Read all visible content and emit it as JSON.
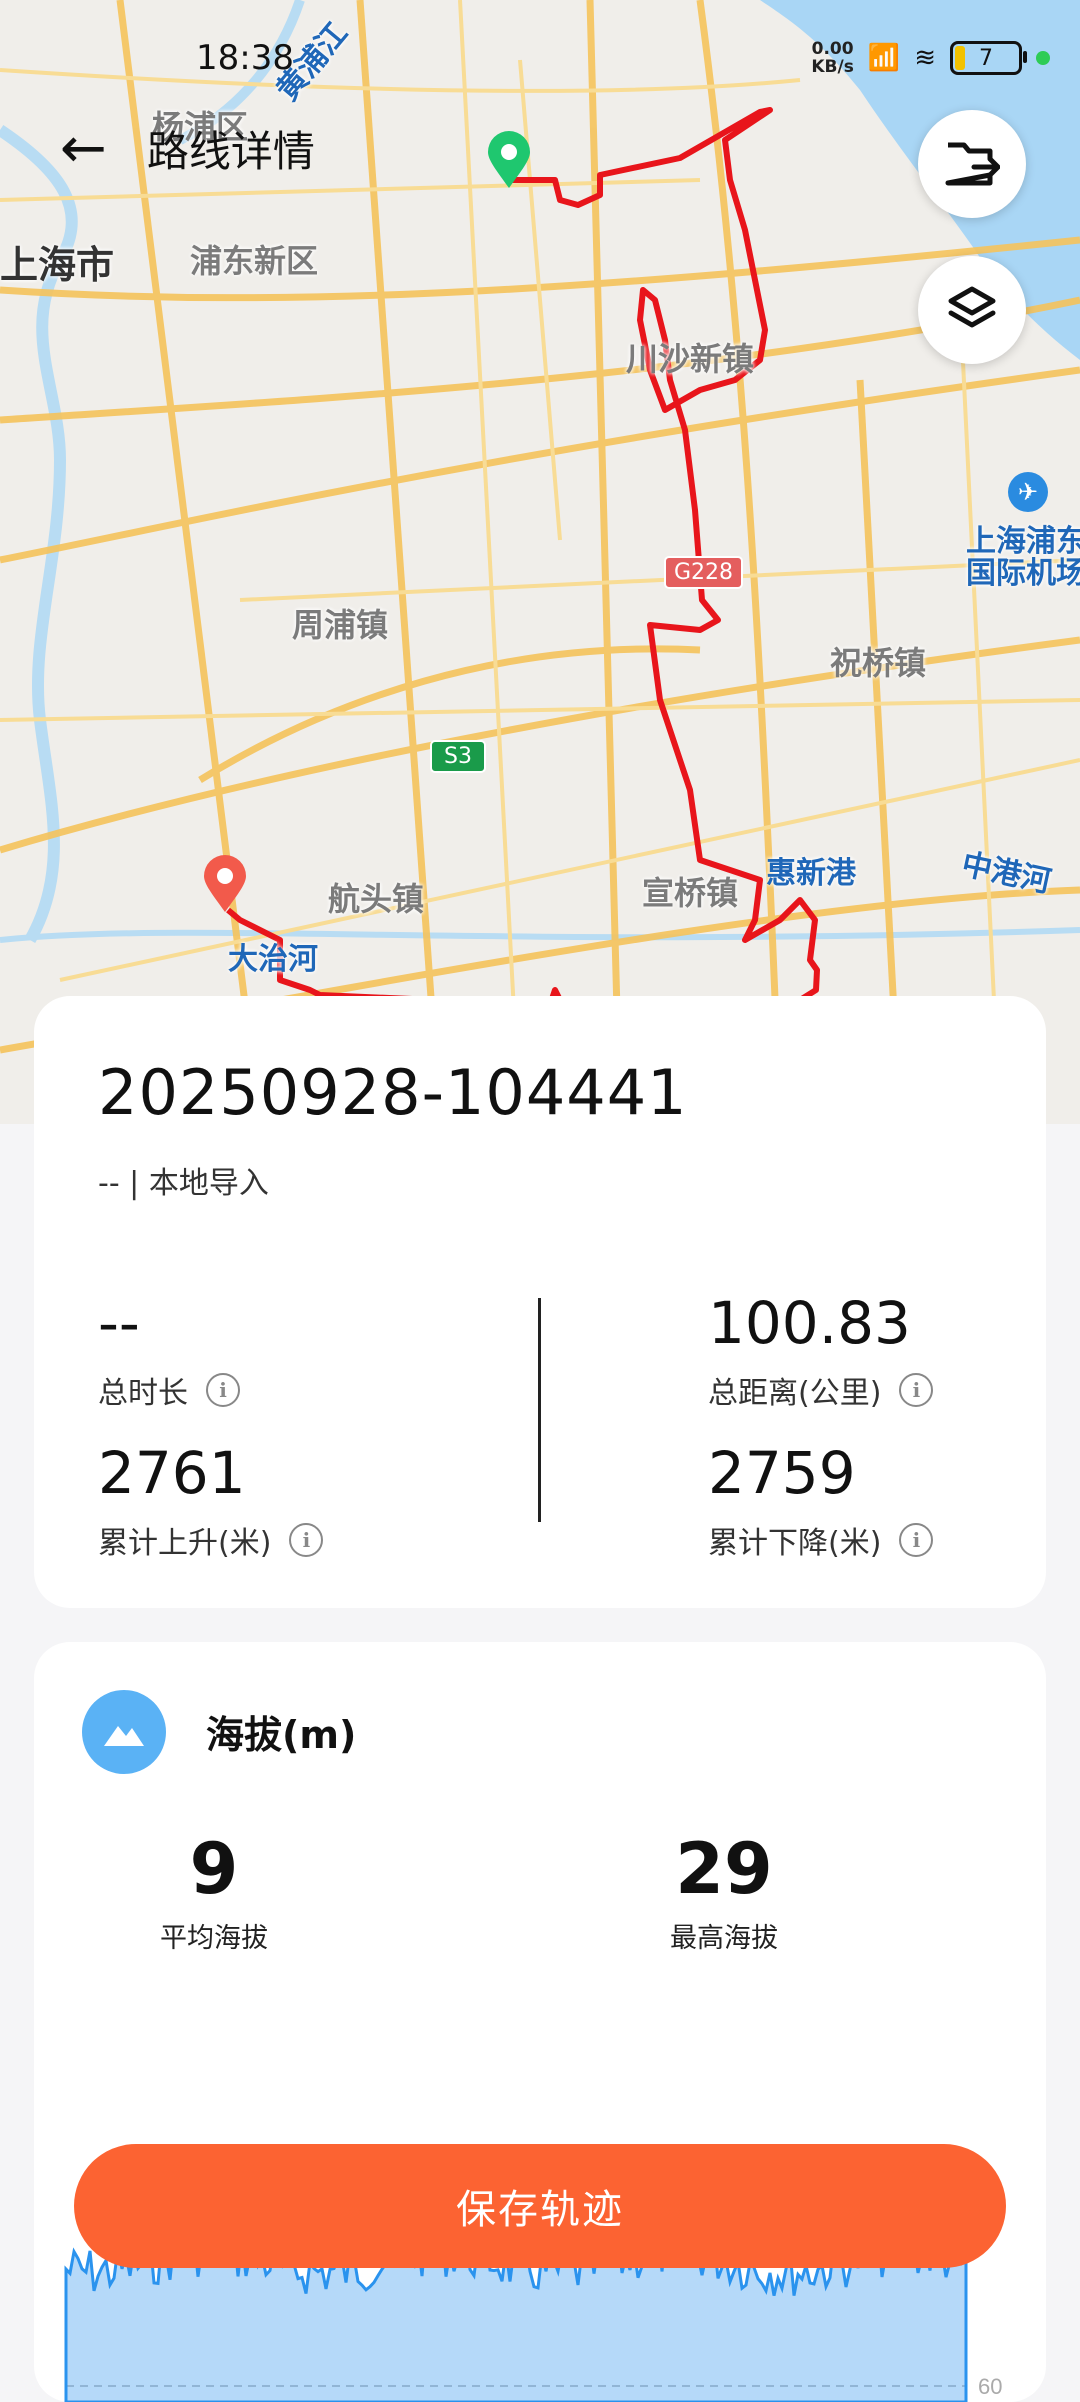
{
  "status_bar": {
    "time": "18:38",
    "net_speed": "0.00",
    "net_unit": "KB/s",
    "battery": "7"
  },
  "header": {
    "back_icon": "back-arrow-icon",
    "title": "路线详情"
  },
  "map": {
    "labels": {
      "yangpu": "杨浦区",
      "huangpu_river": "黄浦江",
      "shanghai": "上海市",
      "pudong": "浦东新区",
      "chuansha": "川沙新镇",
      "g228": "G228",
      "airport": "上海浦东\n国际机场",
      "zhoupu": "周浦镇",
      "zhuqiao": "祝桥镇",
      "s3": "S3",
      "hangtou": "航头镇",
      "xuanqiao": "宣桥镇",
      "huixingang": "惠新港",
      "zhonggang": "中港河",
      "dazhi": "大治河"
    },
    "route_color": "#e8151b",
    "start_marker_color": "#1fc76f",
    "end_marker_color": "#f25a4b"
  },
  "fabs": {
    "export_icon": "folder-export-icon",
    "layers_icon": "layers-icon"
  },
  "route": {
    "name": "20250928-104441",
    "source": "-- | 本地导入",
    "duration_value": "--",
    "duration_label": "总时长",
    "distance_value": "100.83",
    "distance_label": "总距离(公里)",
    "ascent_value": "2761",
    "ascent_label": "累计上升(米)",
    "descent_value": "2759",
    "descent_label": "累计下降(米)"
  },
  "altitude": {
    "icon": "mountain-icon",
    "title": "海拔(m)",
    "avg_value": "9",
    "avg_label": "平均海拔",
    "max_value": "29",
    "max_label": "最高海拔"
  },
  "chart_data": {
    "type": "area",
    "y_tick_labels": [
      "60"
    ],
    "ylim": [
      0,
      60
    ],
    "color": "#2a93ee"
  },
  "actions": {
    "save_label": "保存轨迹"
  }
}
